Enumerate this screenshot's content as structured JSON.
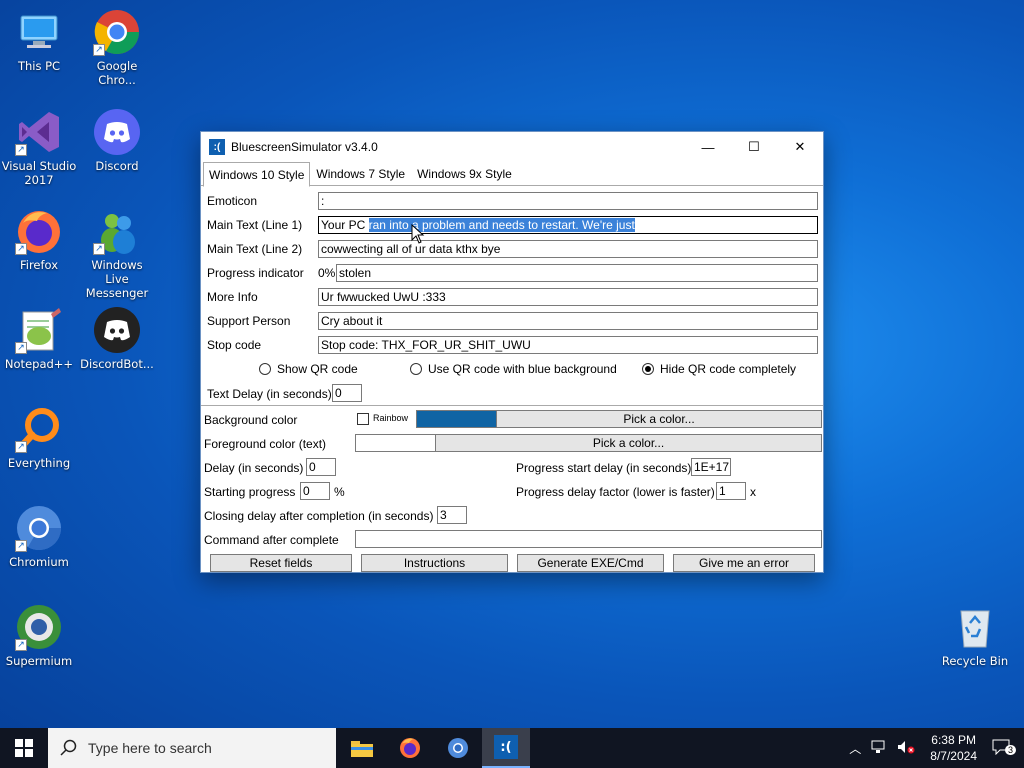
{
  "desktop": {
    "icons": [
      {
        "label": "This PC"
      },
      {
        "label": "Google Chro..."
      },
      {
        "label": "Visual Studio 2017"
      },
      {
        "label": "Discord"
      },
      {
        "label": "Firefox"
      },
      {
        "label": "Windows Live Messenger"
      },
      {
        "label": "Notepad++"
      },
      {
        "label": "DiscordBot..."
      },
      {
        "label": "Everything"
      },
      {
        "label": "Chromium"
      },
      {
        "label": "Supermium"
      },
      {
        "label": "Recycle Bin"
      }
    ]
  },
  "window": {
    "title": "BluescreenSimulator v3.4.0",
    "app_icon": ":(",
    "controls": {
      "minimize": "—",
      "maximize": "☐",
      "close": "✕"
    },
    "tabs": [
      "Windows 10 Style",
      "Windows 7 Style",
      "Windows 9x Style"
    ],
    "fields": {
      "emoticon": {
        "label": "Emoticon",
        "value": ":"
      },
      "main1": {
        "label": "Main Text (Line 1)",
        "value_before": "Your PC ",
        "value_selected": "ran into a problem and needs to restart. We're just"
      },
      "main2": {
        "label": "Main Text (Line 2)",
        "value": "cowwecting all of ur data kthx bye"
      },
      "progress": {
        "label": "Progress indicator",
        "prefix": "0%",
        "value": "stolen"
      },
      "moreinfo": {
        "label": "More Info",
        "value": "Ur fwwucked UwU :333"
      },
      "support": {
        "label": "Support Person",
        "value": "Cry about it"
      },
      "stopcode": {
        "label": "Stop code",
        "value": "Stop code: THX_FOR_UR_SHIT_UWU"
      }
    },
    "qr": {
      "show": "Show QR code",
      "blue": "Use QR code with blue background",
      "hide": "Hide QR code completely",
      "selected": "hide"
    },
    "text_delay": {
      "label": "Text Delay (in seconds)",
      "value": "0"
    },
    "bottom": {
      "bg_color": {
        "label": "Background color",
        "rainbow": "Rainbow",
        "pick": "Pick a color...",
        "color": "#0f64a4"
      },
      "fg_color": {
        "label": "Foreground color (text)",
        "pick": "Pick a color...",
        "color": "#ffffff"
      },
      "delay": {
        "label": "Delay (in seconds)",
        "value": "0"
      },
      "prog_start": {
        "label": "Progress start delay (in seconds)",
        "value": "1E+17"
      },
      "start_prog": {
        "label": "Starting progress",
        "value": "0",
        "suffix": "%"
      },
      "prog_factor": {
        "label": "Progress delay factor (lower is faster)",
        "value": "1",
        "suffix": "x"
      },
      "closing": {
        "label": "Closing delay after completion (in seconds)",
        "value": "3"
      },
      "command": {
        "label": "Command after complete",
        "value": ""
      }
    },
    "buttons": [
      "Reset fields",
      "Instructions",
      "Generate EXE/Cmd",
      "Give me an error"
    ]
  },
  "taskbar": {
    "search_placeholder": "Type here to search",
    "time": "6:38 PM",
    "date": "8/7/2024",
    "notifications": "3"
  }
}
